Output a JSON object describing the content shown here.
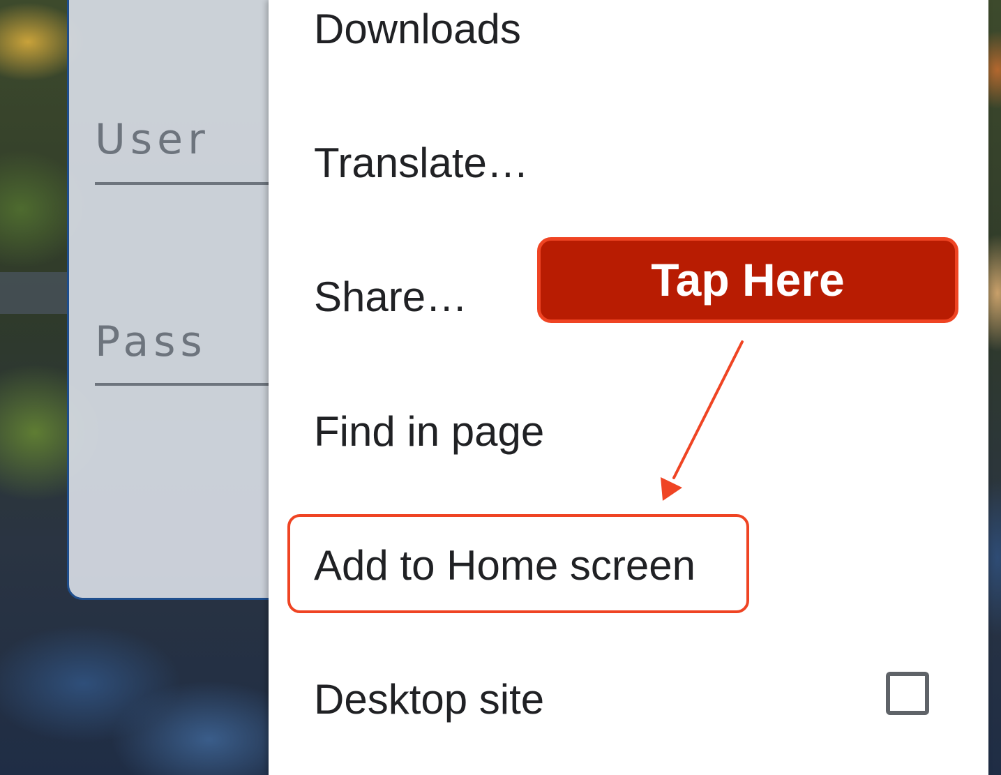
{
  "background": {
    "login_card": {
      "username_label": "User",
      "password_label": "Pass"
    }
  },
  "menu": {
    "items": [
      {
        "label": "Downloads"
      },
      {
        "label": "Translate…"
      },
      {
        "label": "Share…"
      },
      {
        "label": "Find in page"
      },
      {
        "label": "Add to Home screen"
      },
      {
        "label": "Desktop site",
        "checked": false
      }
    ]
  },
  "annotation": {
    "callout_text": "Tap Here",
    "highlight_color": "#ef4423",
    "callout_fill": "#b81c02",
    "highlighted_item": "Add to Home screen"
  }
}
